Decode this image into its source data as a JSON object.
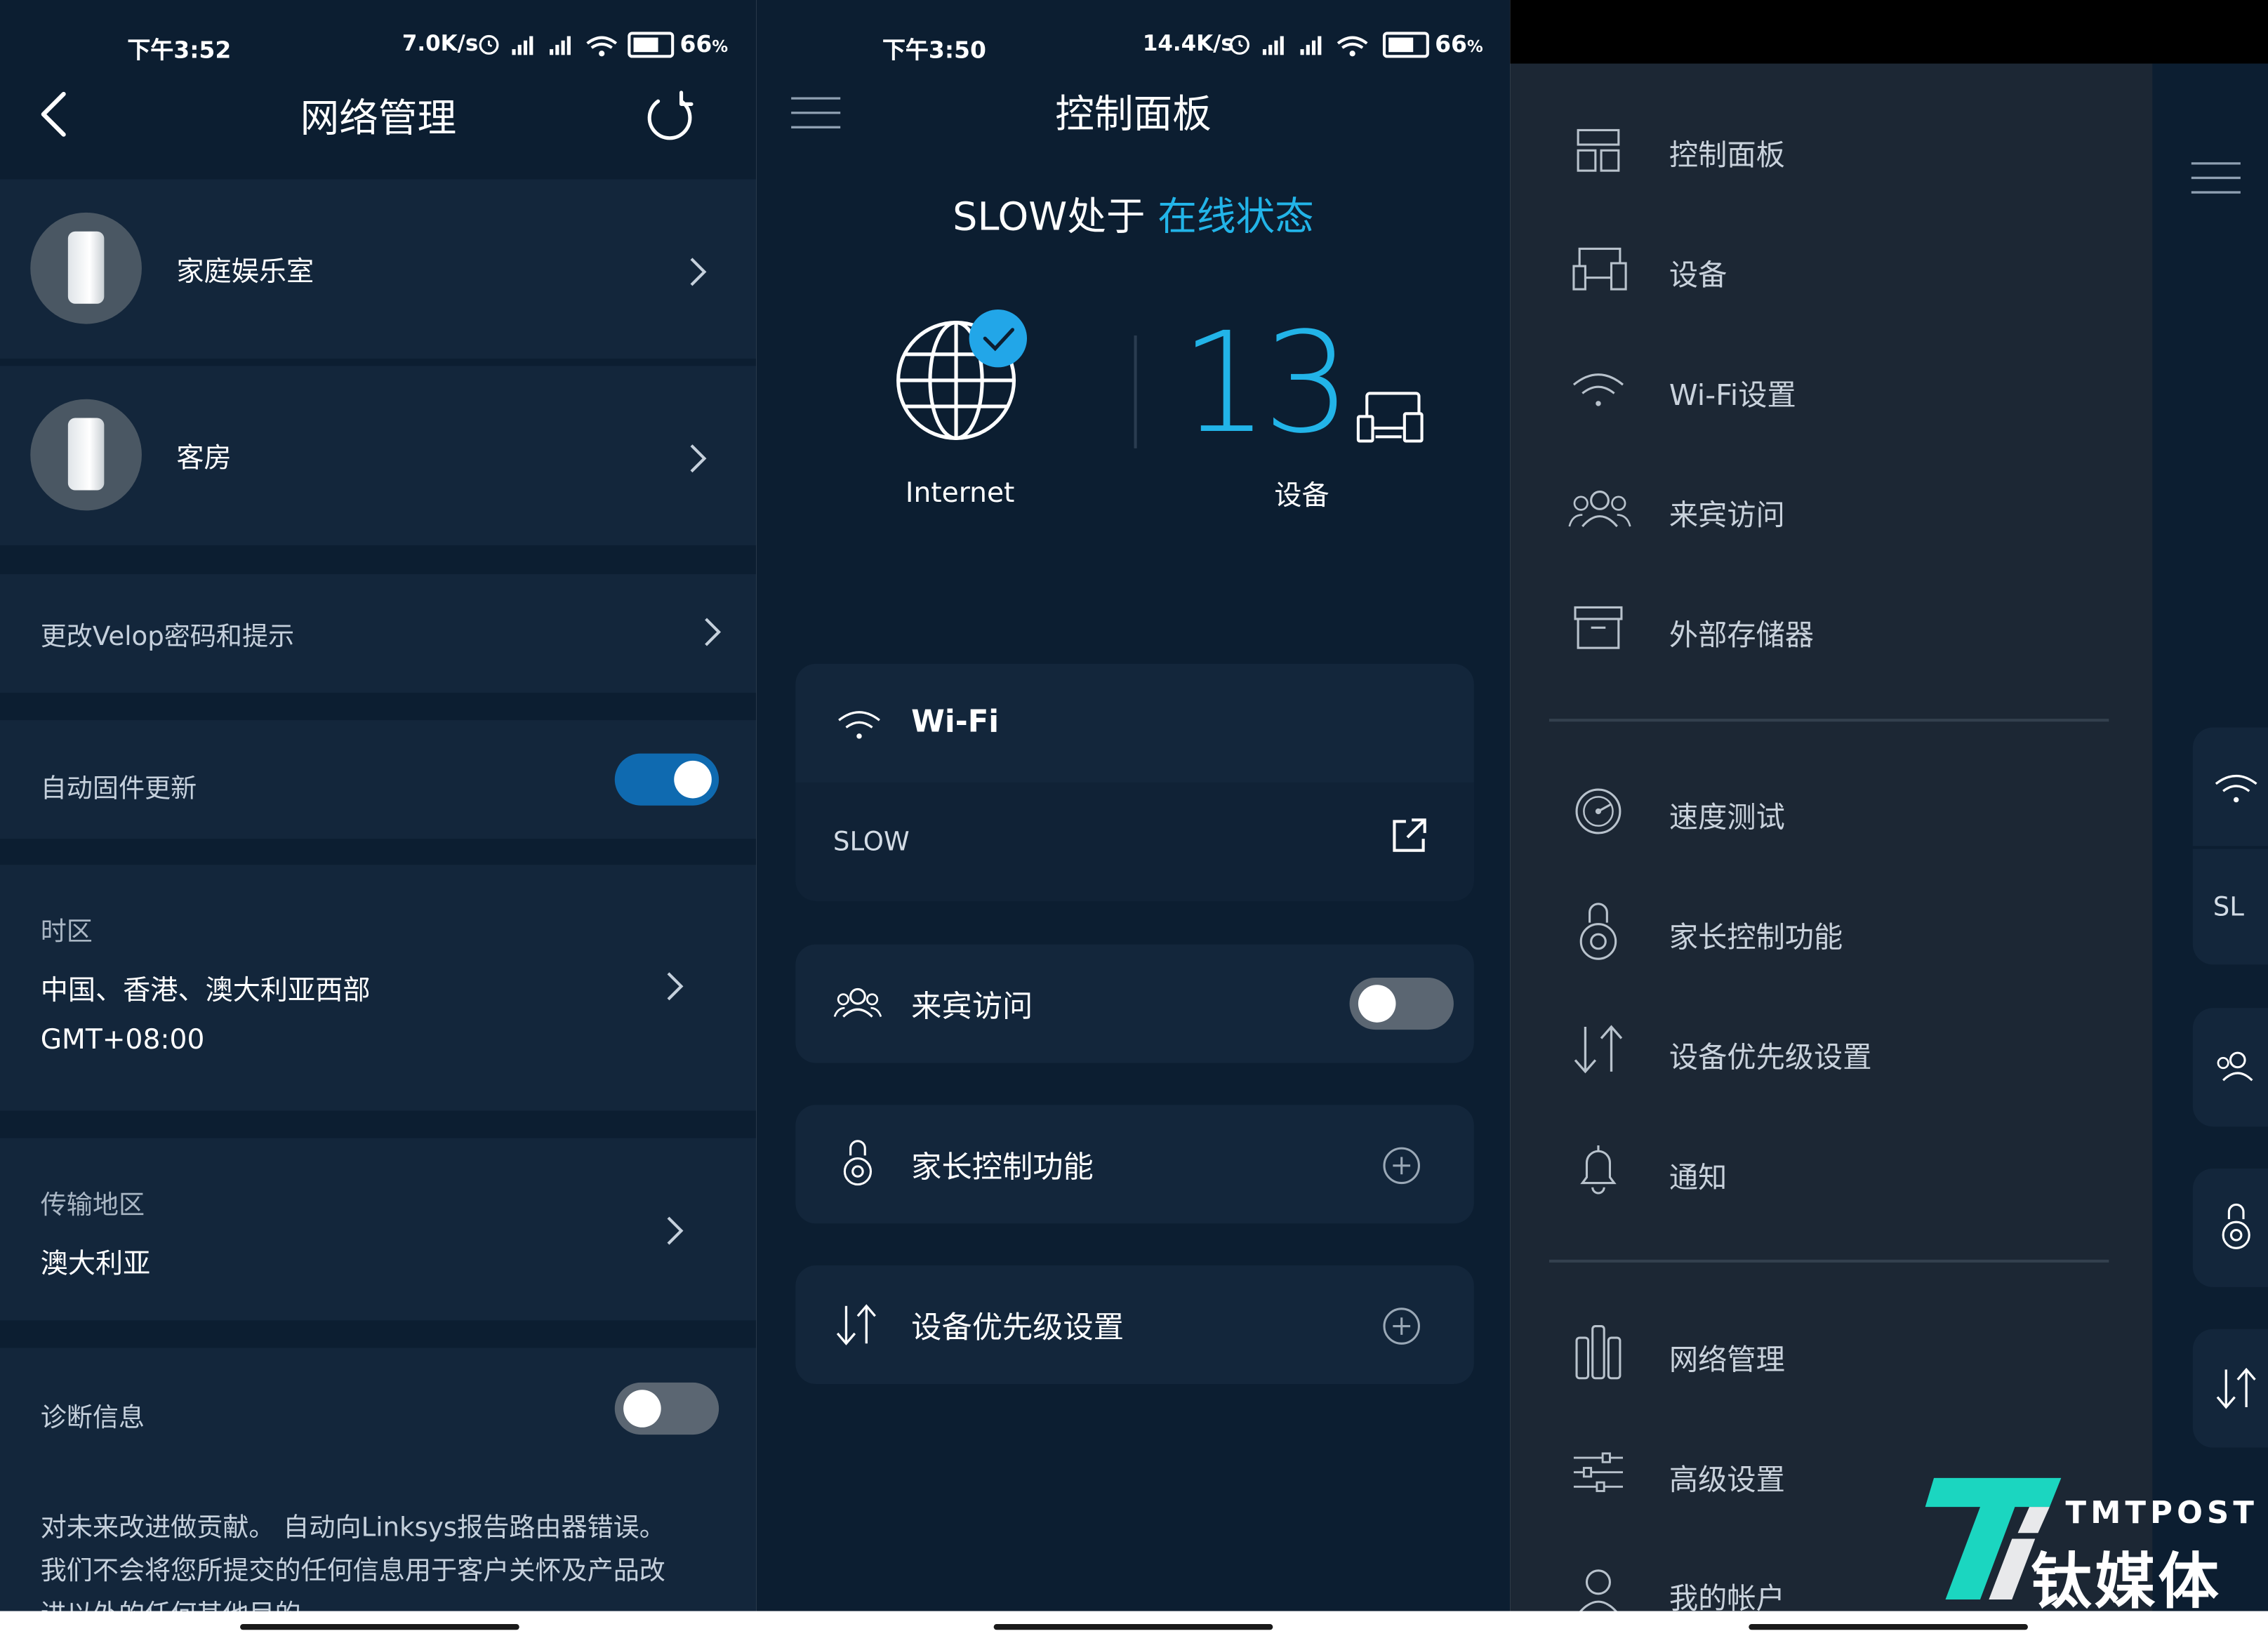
{
  "screens": {
    "network": {
      "status": {
        "time": "下午3:52",
        "speed": "7.0K/s",
        "battery": "66"
      },
      "title": "网络管理",
      "nodes": [
        {
          "name": "家庭娱乐室"
        },
        {
          "name": "客房"
        }
      ],
      "change_password": "更改Velop密码和提示",
      "auto_update": {
        "label": "自动固件更新",
        "on": true
      },
      "timezone": {
        "label": "时区",
        "value": "中国、香港、澳大利亚西部",
        "gmt": "GMT+08:00"
      },
      "region": {
        "label": "传输地区",
        "value": "澳大利亚"
      },
      "diagnostics": {
        "label": "诊断信息",
        "on": false
      },
      "disclaimer": [
        "对未来改进做贡献。 自动向Linksys报告路由器错误。",
        "我们不会将您所提交的任何信息用于客户关怀及产品改",
        "进以外的任何其他目的"
      ]
    },
    "dashboard": {
      "status": {
        "time": "下午3:50",
        "speed": "14.4K/s",
        "battery": "66"
      },
      "title": "控制面板",
      "network_prefix": "SLOW处于",
      "network_state": "在线状态",
      "internet_label": "Internet",
      "device_count": "13",
      "device_label": "设备",
      "wifi": {
        "title": "Wi-Fi",
        "ssid": "SLOW"
      },
      "guest": {
        "title": "来宾访问",
        "on": false
      },
      "parental": {
        "title": "家长控制功能"
      },
      "priority": {
        "title": "设备优先级设置"
      },
      "accent_color": "#22b4e8"
    },
    "menu": {
      "group1": [
        "控制面板",
        "设备",
        "Wi-Fi设置",
        "来宾访问",
        "外部存储器"
      ],
      "group2": [
        "速度测试",
        "家长控制功能",
        "设备优先级设置",
        "通知"
      ],
      "group3": [
        "网络管理",
        "高级设置",
        "我的帐户"
      ],
      "peek_ssid": "SL"
    }
  },
  "watermark": {
    "brand": "TMTPOST",
    "cn": "钛媒体"
  }
}
